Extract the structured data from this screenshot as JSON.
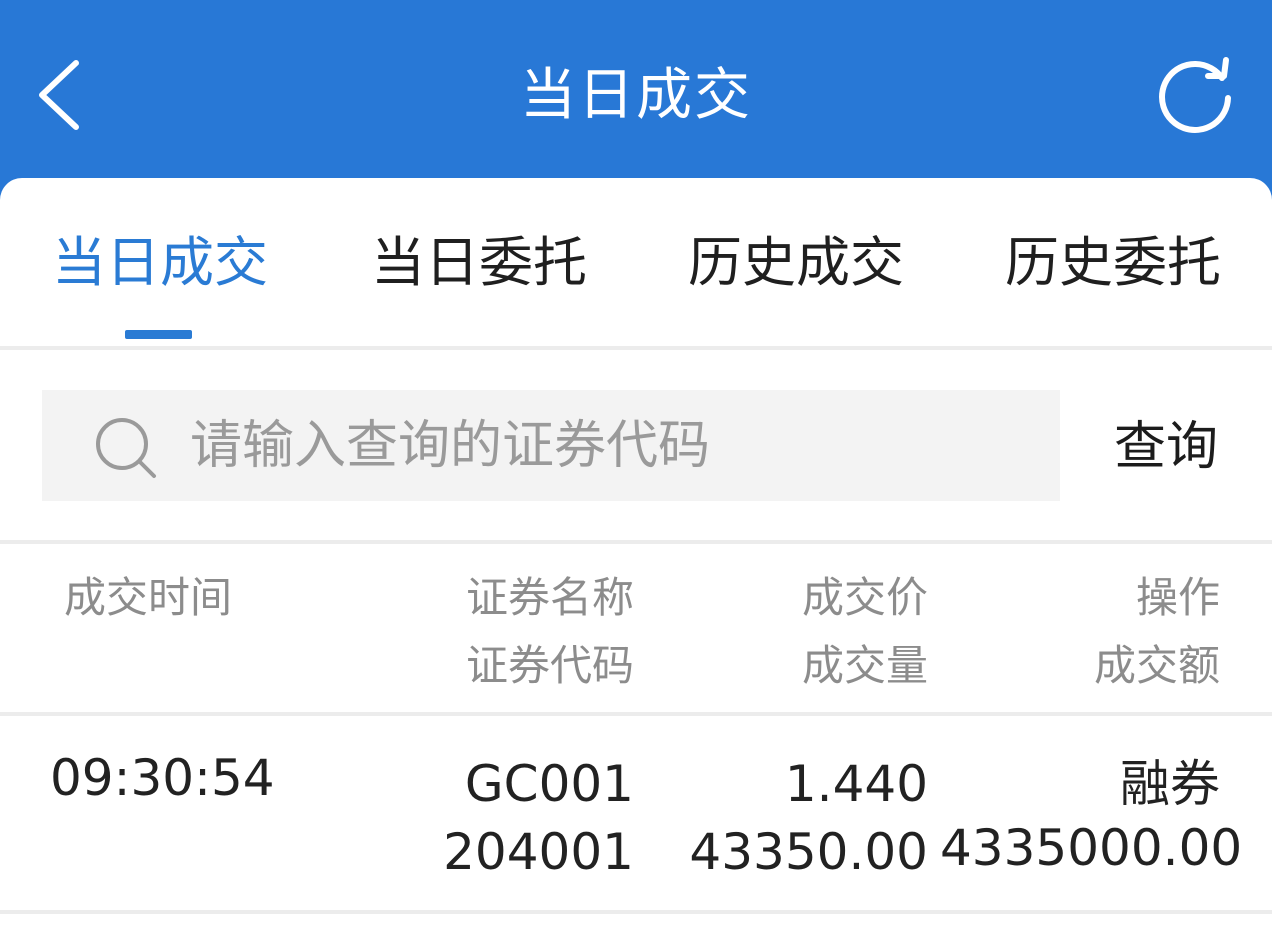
{
  "header": {
    "title": "当日成交",
    "back_icon": "chevron-left-icon",
    "refresh_icon": "refresh-icon"
  },
  "tabs": [
    {
      "label": "当日成交",
      "active": true
    },
    {
      "label": "当日委托",
      "active": false
    },
    {
      "label": "历史成交",
      "active": false
    },
    {
      "label": "历史委托",
      "active": false
    }
  ],
  "search": {
    "placeholder": "请输入查询的证券代码",
    "value": "",
    "button_label": "查询",
    "icon": "search-icon"
  },
  "table": {
    "columns": [
      {
        "line1": "成交时间",
        "line2": ""
      },
      {
        "line1": "证券名称",
        "line2": "证券代码"
      },
      {
        "line1": "成交价",
        "line2": "成交量"
      },
      {
        "line1": "操作",
        "line2": "成交额"
      }
    ],
    "rows": [
      {
        "time": "09:30:54",
        "name": "GC001",
        "code": "204001",
        "price": "1.440",
        "volume": "43350.00",
        "operation": "融券",
        "amount": "4335000.00"
      }
    ]
  },
  "colors": {
    "brand": "#2878d6",
    "active_tab": "#2a7bd4",
    "muted_text": "#8c8c8c"
  }
}
